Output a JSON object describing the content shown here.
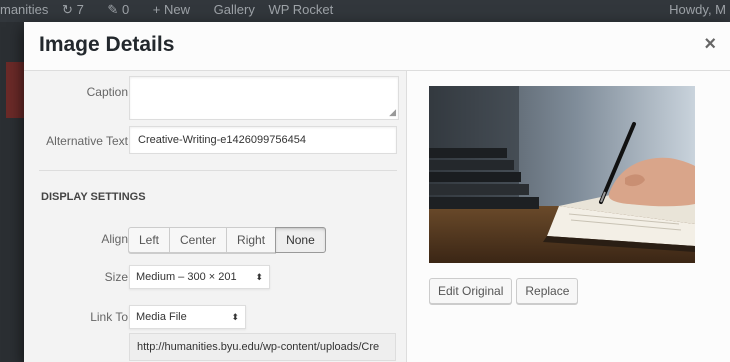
{
  "admin_bar": {
    "items": [
      "manities",
      "7",
      "0",
      "New",
      "Gallery",
      "WP Rocket"
    ],
    "greeting": "Howdy, M"
  },
  "modal": {
    "title": "Image Details",
    "close_symbol": "×"
  },
  "fields": {
    "caption_label": "Caption",
    "caption_value": "",
    "alt_label": "Alternative Text",
    "alt_value": "Creative-Writing-e1426099756454"
  },
  "display_settings": {
    "title": "DISPLAY SETTINGS",
    "align_label": "Align",
    "align_options": [
      "Left",
      "Center",
      "Right",
      "None"
    ],
    "align_selected": "None",
    "size_label": "Size",
    "size_value": "Medium – 300 × 201",
    "link_label": "Link To",
    "link_value": "Media File",
    "link_url": "http://humanities.byu.edu/wp-content/uploads/Cre"
  },
  "preview": {
    "edit_original_label": "Edit Original",
    "replace_label": "Replace"
  },
  "icons": {
    "select_arrow": "⬍",
    "resize_grip": "◢"
  }
}
